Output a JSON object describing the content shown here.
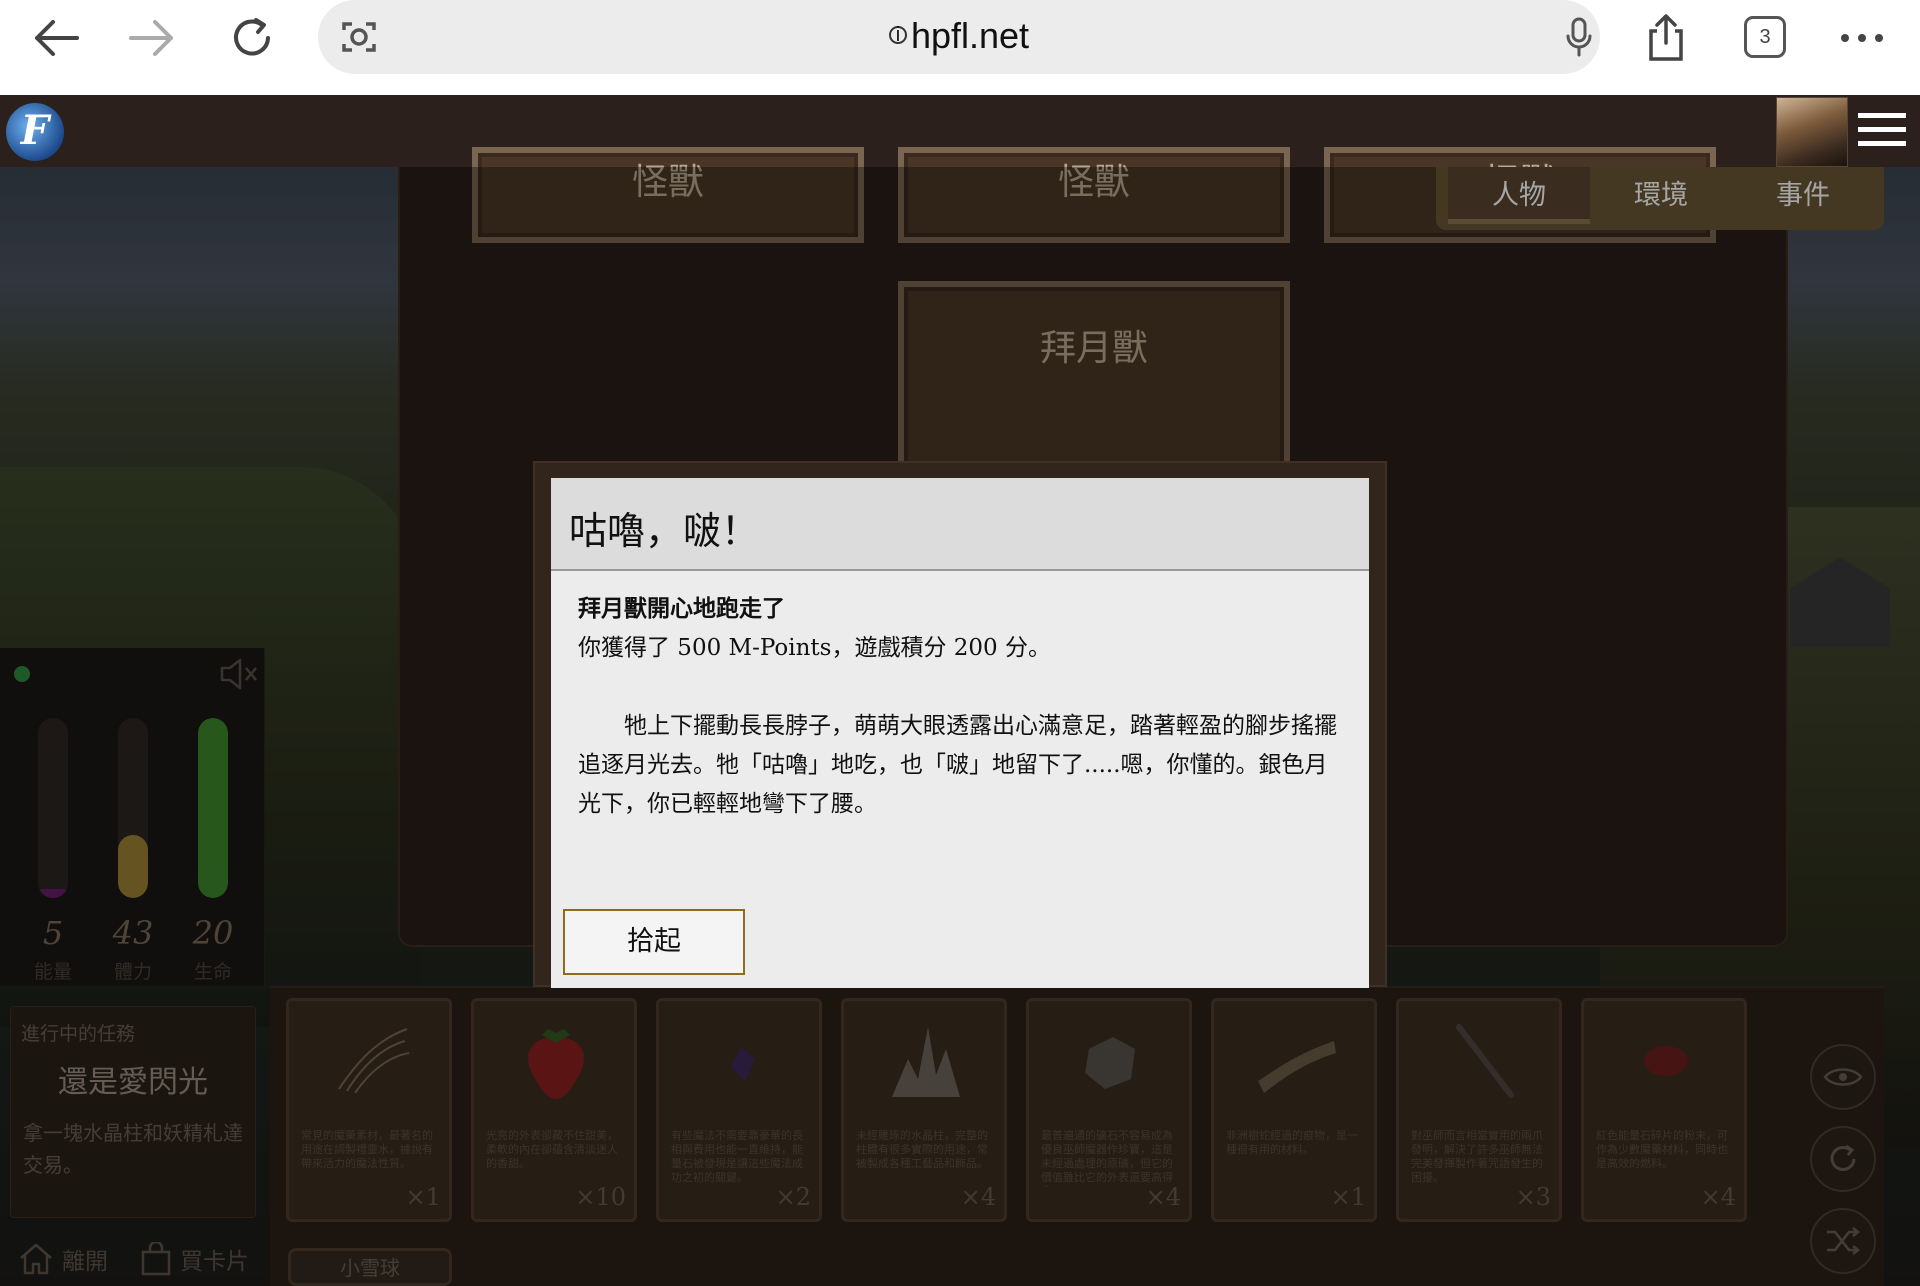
{
  "browser": {
    "url": "hpfl.net",
    "tab_count": "3"
  },
  "board": {
    "cards_top": [
      "怪獸",
      "怪獸",
      "怪獸"
    ],
    "center_card": "拜月獸"
  },
  "tabs": [
    {
      "label": "人物",
      "active": true
    },
    {
      "label": "環境",
      "active": false
    },
    {
      "label": "事件",
      "active": false
    }
  ],
  "status": {
    "gauges": [
      {
        "value": "5",
        "label": "能量",
        "level": 0.05,
        "color": "#6a1e6e"
      },
      {
        "value": "43",
        "label": "體力",
        "level": 0.35,
        "color": "#a08434"
      },
      {
        "value": "20",
        "label": "生命",
        "level": 1.0,
        "color": "#3f8a2c"
      }
    ]
  },
  "quest": {
    "header": "進行中的任務",
    "title": "還是愛閃光",
    "description": "拿一塊水晶柱和妖精札達交易。"
  },
  "bottom_links": {
    "leave": "離開",
    "buy_cards": "買卡片"
  },
  "inventory": {
    "items": [
      {
        "name": "hair",
        "desc": "常見的魔藥素材，最著名的用途在調製禮靈水，據說有帶來活力的魔法性質。",
        "qty": "×1"
      },
      {
        "name": "strawberry",
        "desc": "光亮的外表卻藏不住甜美，柔軟的內在卻蘊含清淡迷人的香甜。",
        "qty": "×10"
      },
      {
        "name": "gem",
        "desc": "有些魔法不需要靠豪華的長相與費用也能一直維持，能量石被發現是讓這些魔法成功之初的關鍵。",
        "qty": "×2"
      },
      {
        "name": "crystal",
        "desc": "未經雕琢的水晶柱，完整的柱體有很多實際的用途，常被製成各種工藝品和飾品。",
        "qty": "×4"
      },
      {
        "name": "ore",
        "desc": "最普遍通的礦石不容易成為優良巫師魔器作珍寶，這是未經過處理的原礦，但它的價值雖比它的外表還要高得多。",
        "qty": "×4"
      },
      {
        "name": "wood",
        "desc": "非洲樹蛇經過的痕物，是一種很有用的材料。",
        "qty": "×1"
      },
      {
        "name": "nail",
        "desc": "對巫師而言相當實用的兩爪發明，解決了許多巫師無法完美發揮製作著咒語發生的困擾。",
        "qty": "×3"
      },
      {
        "name": "red-stone",
        "desc": "紅色能量石碎片的粉末，可作為少數魔藥材料，同時也是高效的燃料。",
        "qty": "×4"
      }
    ],
    "tab_label": "小雪球"
  },
  "dialog": {
    "title": "咕嚕，啵！",
    "lead": "拜月獸開心地跑走了",
    "reward": "你獲得了 500 M-Points，遊戲積分 200 分。",
    "story": "牠上下擺動長長脖子，萌萌大眼透露出心滿意足，踏著輕盈的腳步搖擺追逐月光去。牠「咕嚕」地吃，也「啵」地留下了.....嗯，你懂的。銀色月光下，你已輕輕地彎下了腰。",
    "button": "拾起"
  }
}
